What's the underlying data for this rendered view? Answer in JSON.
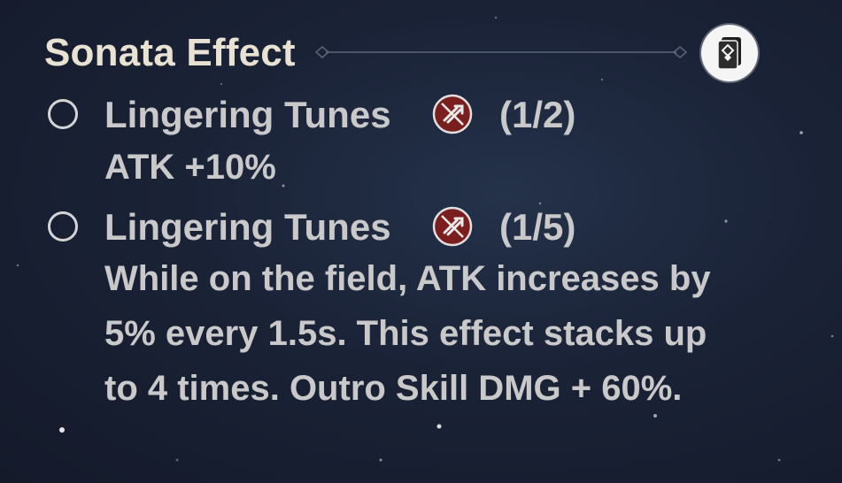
{
  "header": {
    "title": "Sonata Effect",
    "badge_icon": "echo-set-card-icon"
  },
  "effects": [
    {
      "name": "Lingering Tunes",
      "status_icon": "set-inactive-icon",
      "count": "(1/2)",
      "description": "ATK +10%"
    },
    {
      "name": "Lingering Tunes",
      "status_icon": "set-inactive-icon",
      "count": "(1/5)",
      "description_lines": [
        "While on the field, ATK increases by",
        "5% every 1.5s. This effect stacks up",
        "to 4 times. Outro Skill DMG + 60%."
      ]
    }
  ],
  "colors": {
    "title": "#e9e2d3",
    "text": "#c9c9c9",
    "inactive_icon": "#7a1e1e"
  }
}
